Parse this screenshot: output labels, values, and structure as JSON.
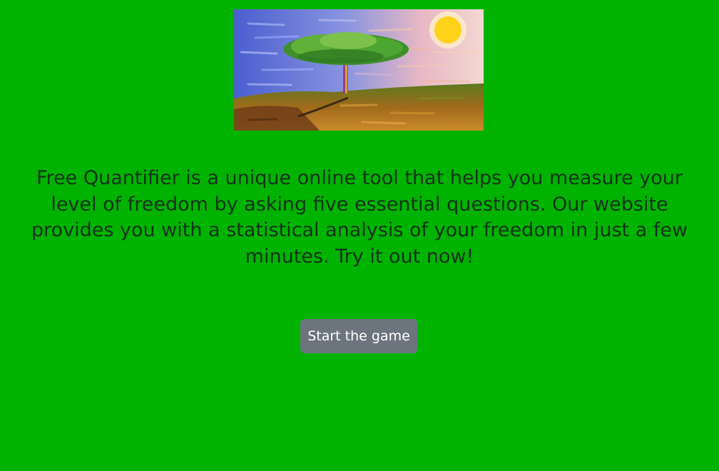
{
  "hero": {
    "alt": "painting-of-tree-under-sun"
  },
  "intro": {
    "text": "Free Quantifier is a unique online tool that helps you measure your level of freedom by asking five essential questions. Our website provides you with a statistical analysis of your freedom in just a few minutes. Try it out now!"
  },
  "actions": {
    "start_label": "Start the game"
  },
  "colors": {
    "background": "#00b300",
    "text": "#14321a",
    "button": "#6c757d",
    "button_text": "#ffffff"
  }
}
